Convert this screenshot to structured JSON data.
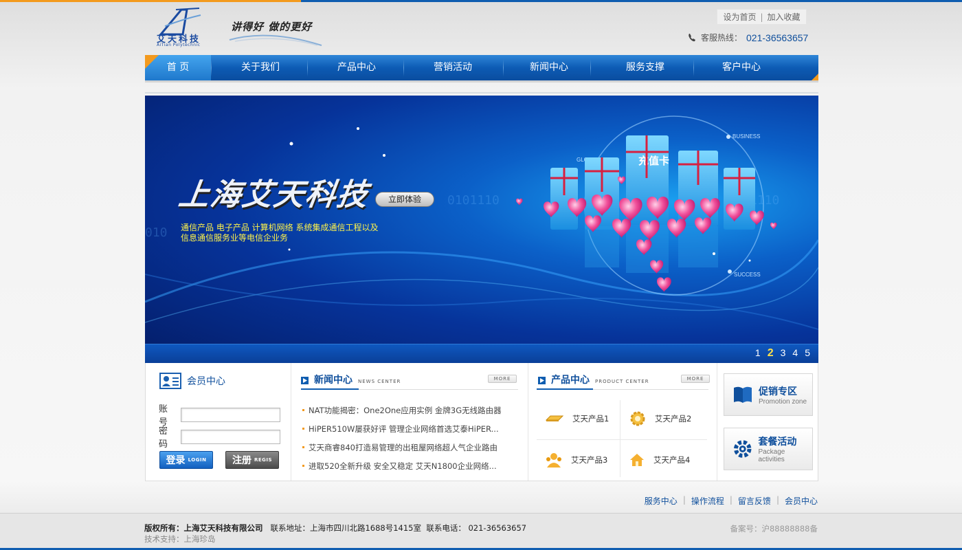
{
  "header": {
    "logo_text": "艾天科技",
    "logo_sub": "AiTian Polytechnic",
    "slogan": "讲得好 做的更好",
    "top_links": [
      "设为首页",
      "加入收藏"
    ],
    "hotline_label": "客服热线：",
    "hotline_number": "021-36563657"
  },
  "nav": {
    "items": [
      "首 页",
      "关于我们",
      "产品中心",
      "营销活动",
      "新闻中心",
      "服务支撑",
      "客户中心"
    ]
  },
  "banner": {
    "title": "上海艾天科技",
    "button": "立即体验",
    "description": "通信产品 电子产品 计算机网络 系统集成通信工程以及信息通信服务业等电信企业务",
    "cards_text": "充值卡",
    "labels": [
      "BUSINESS",
      "GLOBAL",
      "SUCCESS"
    ],
    "pages": [
      "1",
      "2",
      "3",
      "4",
      "5"
    ],
    "active_page": "2"
  },
  "member": {
    "title": "会员中心",
    "account_label": "账号",
    "password_label": "密码",
    "account_value": "",
    "password_value": "",
    "login_label": "登录",
    "login_sub": "LOGIN",
    "register_label": "注册",
    "register_sub": "REGIS"
  },
  "news": {
    "title": "新闻中心",
    "subtitle": "NEWS CENTER",
    "more": "MORE",
    "items": [
      "NAT功能揭密：One2One应用实例 金牌3G无线路由器",
      "HiPER510W屡获好评 管理企业网络首选艾泰HiPER...",
      "艾天商睿840打造易管理的出租屋网络超人气企业路由",
      "进取520全新升级 安全又稳定 艾天N1800企业网络..."
    ]
  },
  "products": {
    "title": "产品中心",
    "subtitle": "PRODUCT CENTER",
    "more": "MORE",
    "items": [
      "艾天产品1",
      "艾天产品2",
      "艾天产品3",
      "艾天产品4"
    ]
  },
  "promos": [
    {
      "title": "促销专区",
      "subtitle": "Promotion zone"
    },
    {
      "title": "套餐活动",
      "subtitle": "Package activities"
    }
  ],
  "footer": {
    "links": [
      "服务中心",
      "操作流程",
      "留言反馈",
      "会员中心"
    ],
    "copyright_label": "版权所有：",
    "copyright_company": "上海艾天科技有限公司",
    "address_label": "联系地址：",
    "address": "上海市四川北路1688号1415室",
    "phone_label": "联系电话：",
    "phone": "021-36563657",
    "support": "技术支持：上海珍岛",
    "icp": "备案号：沪88888888备"
  },
  "colors": {
    "brand_blue": "#0f5db0",
    "accent_orange": "#f39a1e",
    "banner_text_yellow": "#fff34a"
  }
}
